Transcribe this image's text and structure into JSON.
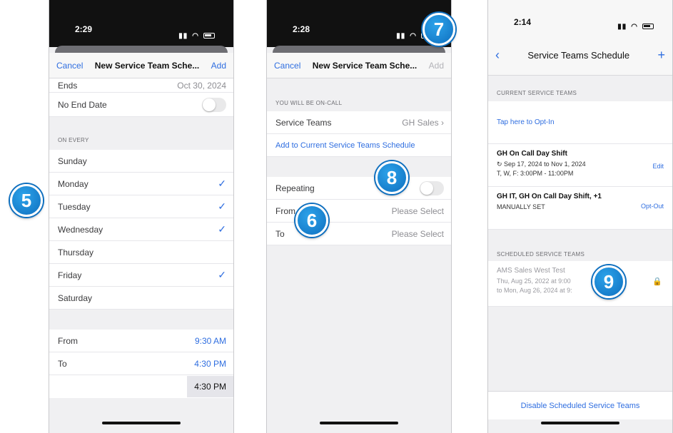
{
  "badges": [
    "5",
    "6",
    "7",
    "8",
    "9"
  ],
  "screen1": {
    "time": "2:29",
    "nav": {
      "cancel": "Cancel",
      "title": "New Service Team Sche...",
      "add": "Add"
    },
    "ends": {
      "label": "Ends",
      "value": "Oct 30, 2024"
    },
    "no_end_date": "No End Date",
    "on_every_header": "ON EVERY",
    "days": [
      {
        "label": "Sunday",
        "checked": ""
      },
      {
        "label": "Monday",
        "checked": "✓"
      },
      {
        "label": "Tuesday",
        "checked": "✓"
      },
      {
        "label": "Wednesday",
        "checked": "✓"
      },
      {
        "label": "Thursday",
        "checked": ""
      },
      {
        "label": "Friday",
        "checked": "✓"
      },
      {
        "label": "Saturday",
        "checked": ""
      }
    ],
    "from": {
      "label": "From",
      "value": "9:30 AM"
    },
    "to": {
      "label": "To",
      "value": "4:30 PM"
    },
    "picker_value": "4:30 PM"
  },
  "screen2": {
    "time": "2:28",
    "nav": {
      "cancel": "Cancel",
      "title": "New Service Team Sche...",
      "add": "Add"
    },
    "on_call_header": "YOU WILL BE ON-CALL",
    "service_teams": {
      "label": "Service Teams",
      "value": "GH Sales"
    },
    "add_link": "Add to Current Service Teams Schedule",
    "repeating": "Repeating",
    "from": {
      "label": "From",
      "value": "Please Select"
    },
    "to": {
      "label": "To",
      "value": "Please Select"
    }
  },
  "screen3": {
    "time": "2:14",
    "title": "Service Teams Schedule",
    "current_header": "CURRENT SERVICE TEAMS",
    "opt_in": "Tap here to Opt-In",
    "shift1": {
      "title": "GH On Call Day Shift",
      "dates": "Sep 17, 2024 to Nov 1, 2024",
      "days": "T, W, F: 3:00PM - 11:00PM",
      "action": "Edit"
    },
    "shift2": {
      "title": "GH IT, GH On Call Day Shift, +1",
      "sub": "MANUALLY SET",
      "action": "Opt-Out"
    },
    "scheduled_header": "SCHEDULED SERVICE TEAMS",
    "scheduled": {
      "title": "AMS Sales West Test",
      "line1": "Thu, Aug 25, 2022 at 9:00",
      "line2": "to Mon, Aug 26, 2024 at 9:"
    },
    "disable": "Disable Scheduled Service Teams"
  }
}
